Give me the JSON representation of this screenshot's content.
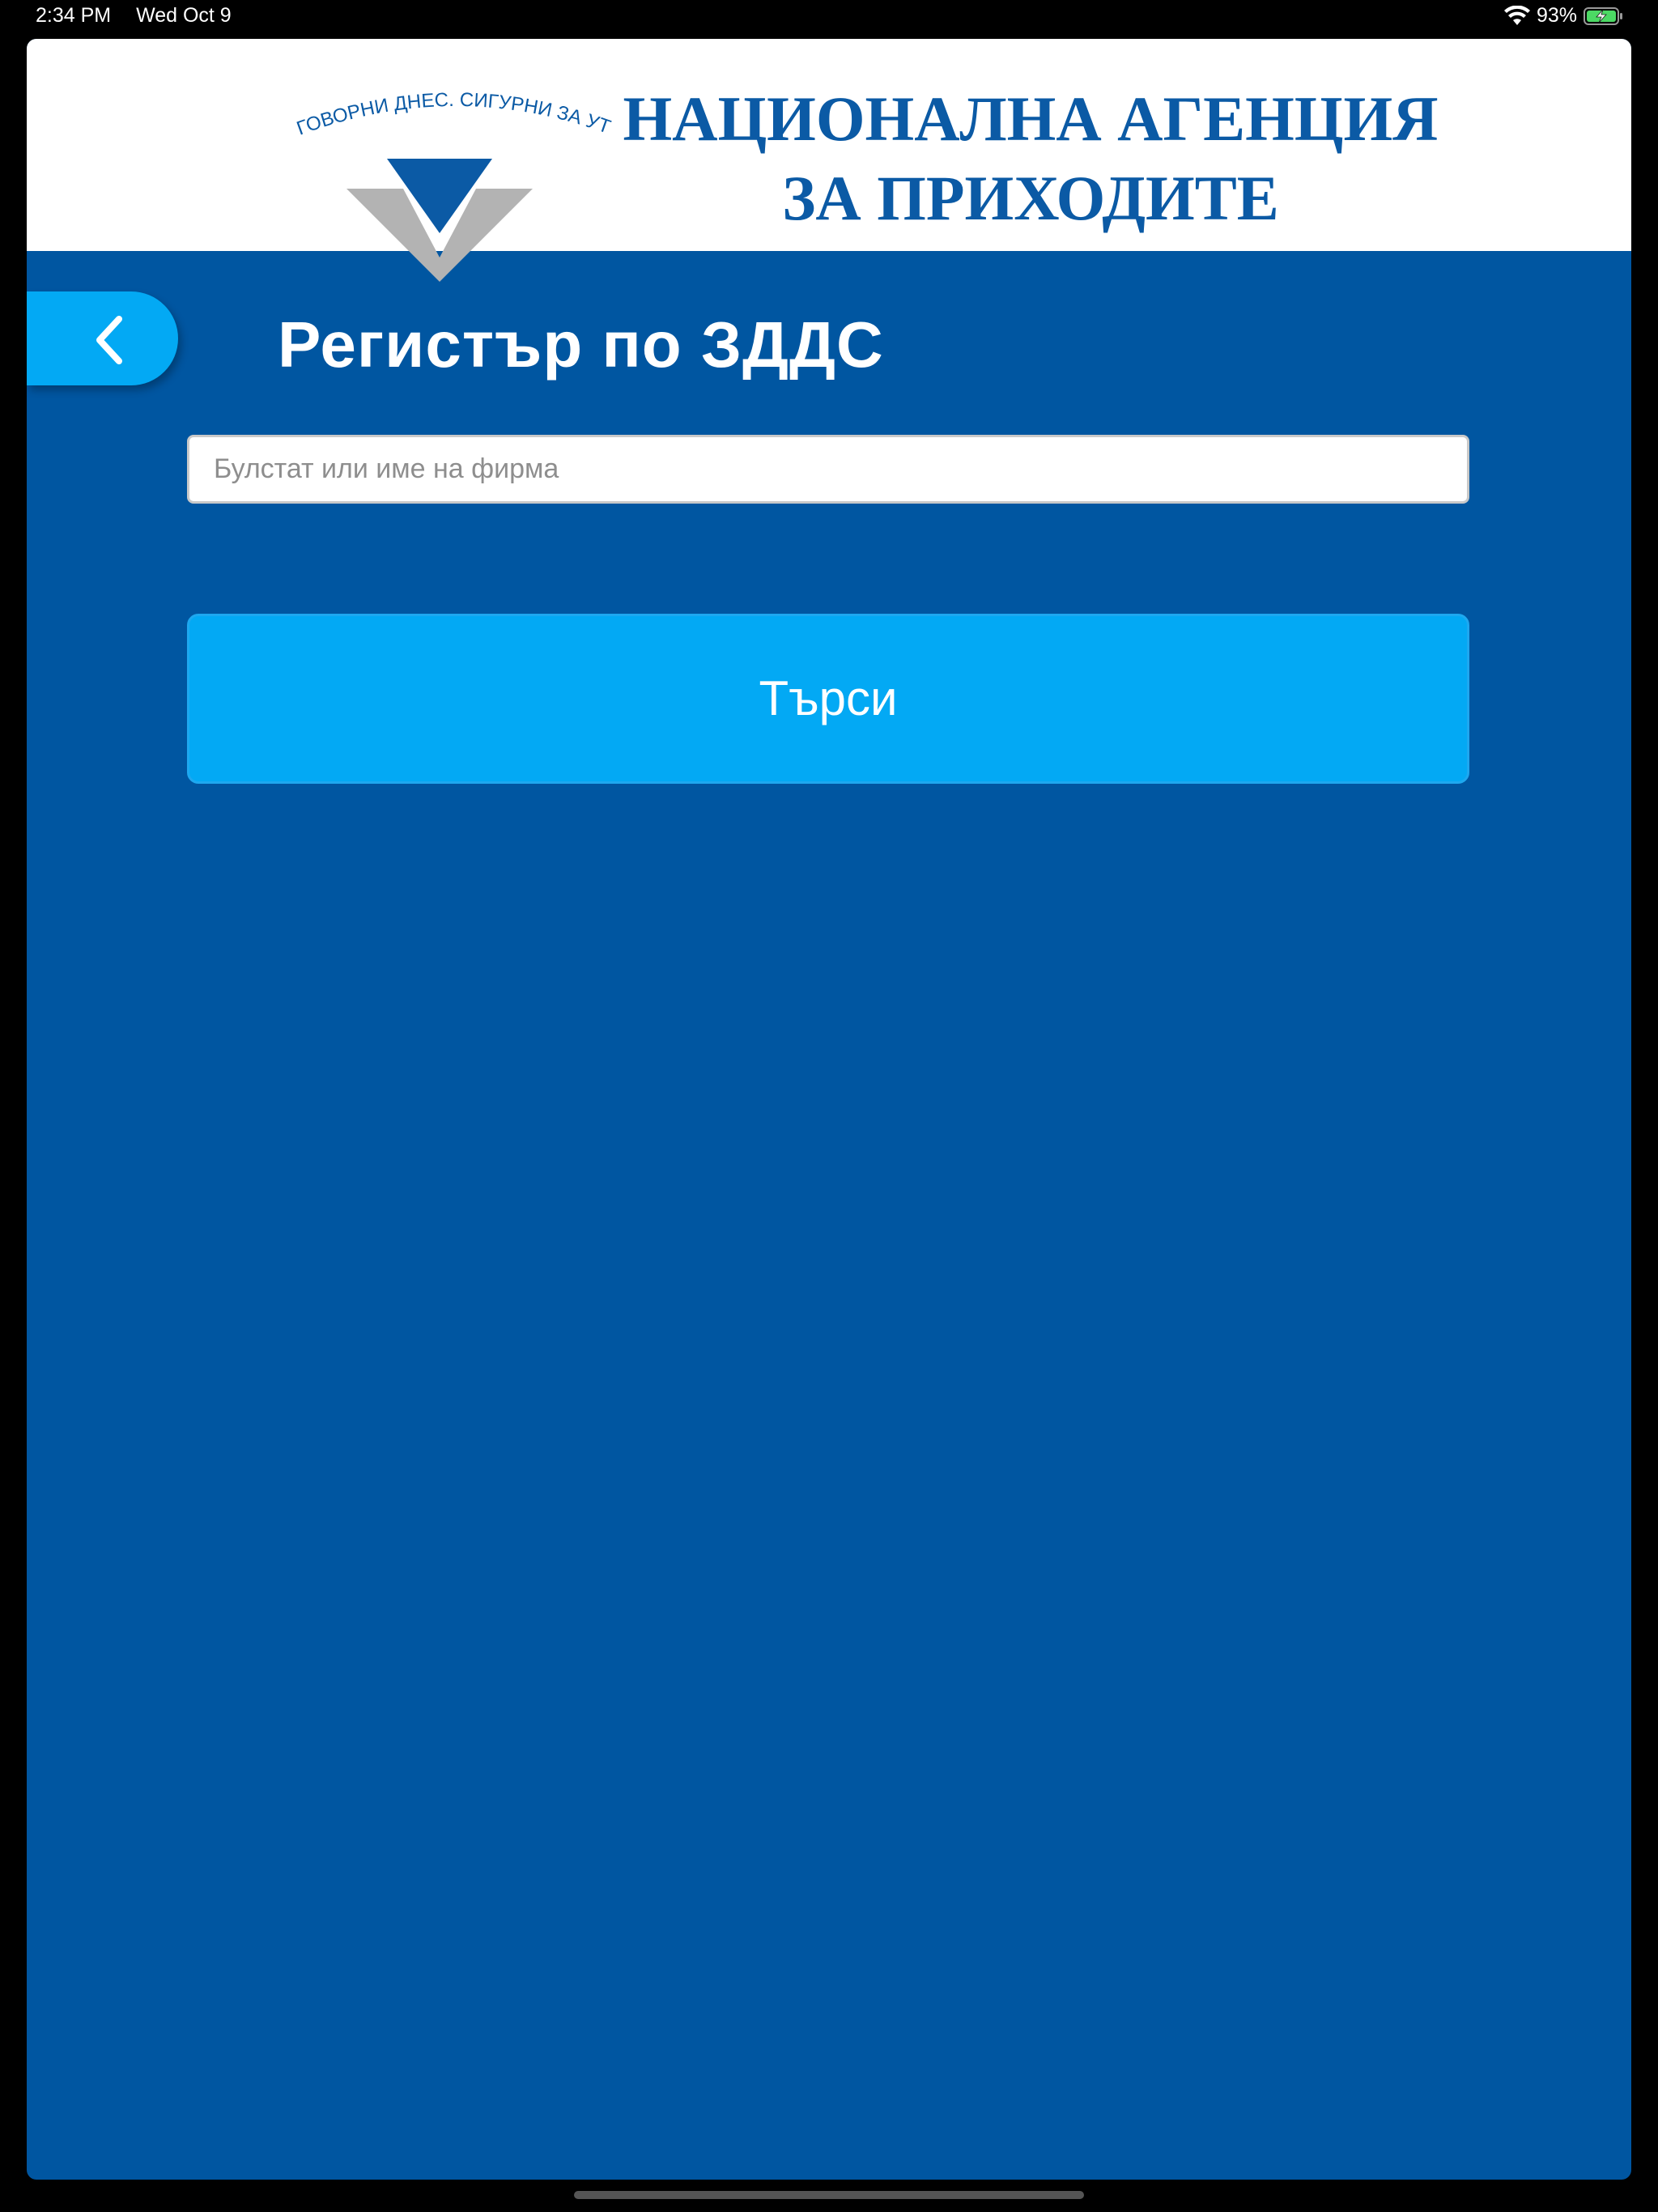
{
  "status_bar": {
    "time": "2:34 PM",
    "date": "Wed Oct 9",
    "battery_percent": "93%",
    "icons": [
      "wifi-icon",
      "battery-charging-icon"
    ]
  },
  "header": {
    "motto": "ОТГОВОРНИ ДНЕС. СИГУРНИ ЗА УТРЕ.",
    "agency_line1": "НАЦИОНАЛНА АГЕНЦИЯ",
    "agency_line2": "ЗА ПРИХОДИТЕ"
  },
  "page": {
    "title": "Регистър по ЗДДС",
    "back_icon": "chevron-left-icon"
  },
  "search": {
    "placeholder": "Булстат или име на фирма",
    "value": "",
    "button_label": "Търси"
  },
  "colors": {
    "background": "#0056a1",
    "accent": "#03a9f4",
    "header_text": "#0b5aa5"
  }
}
